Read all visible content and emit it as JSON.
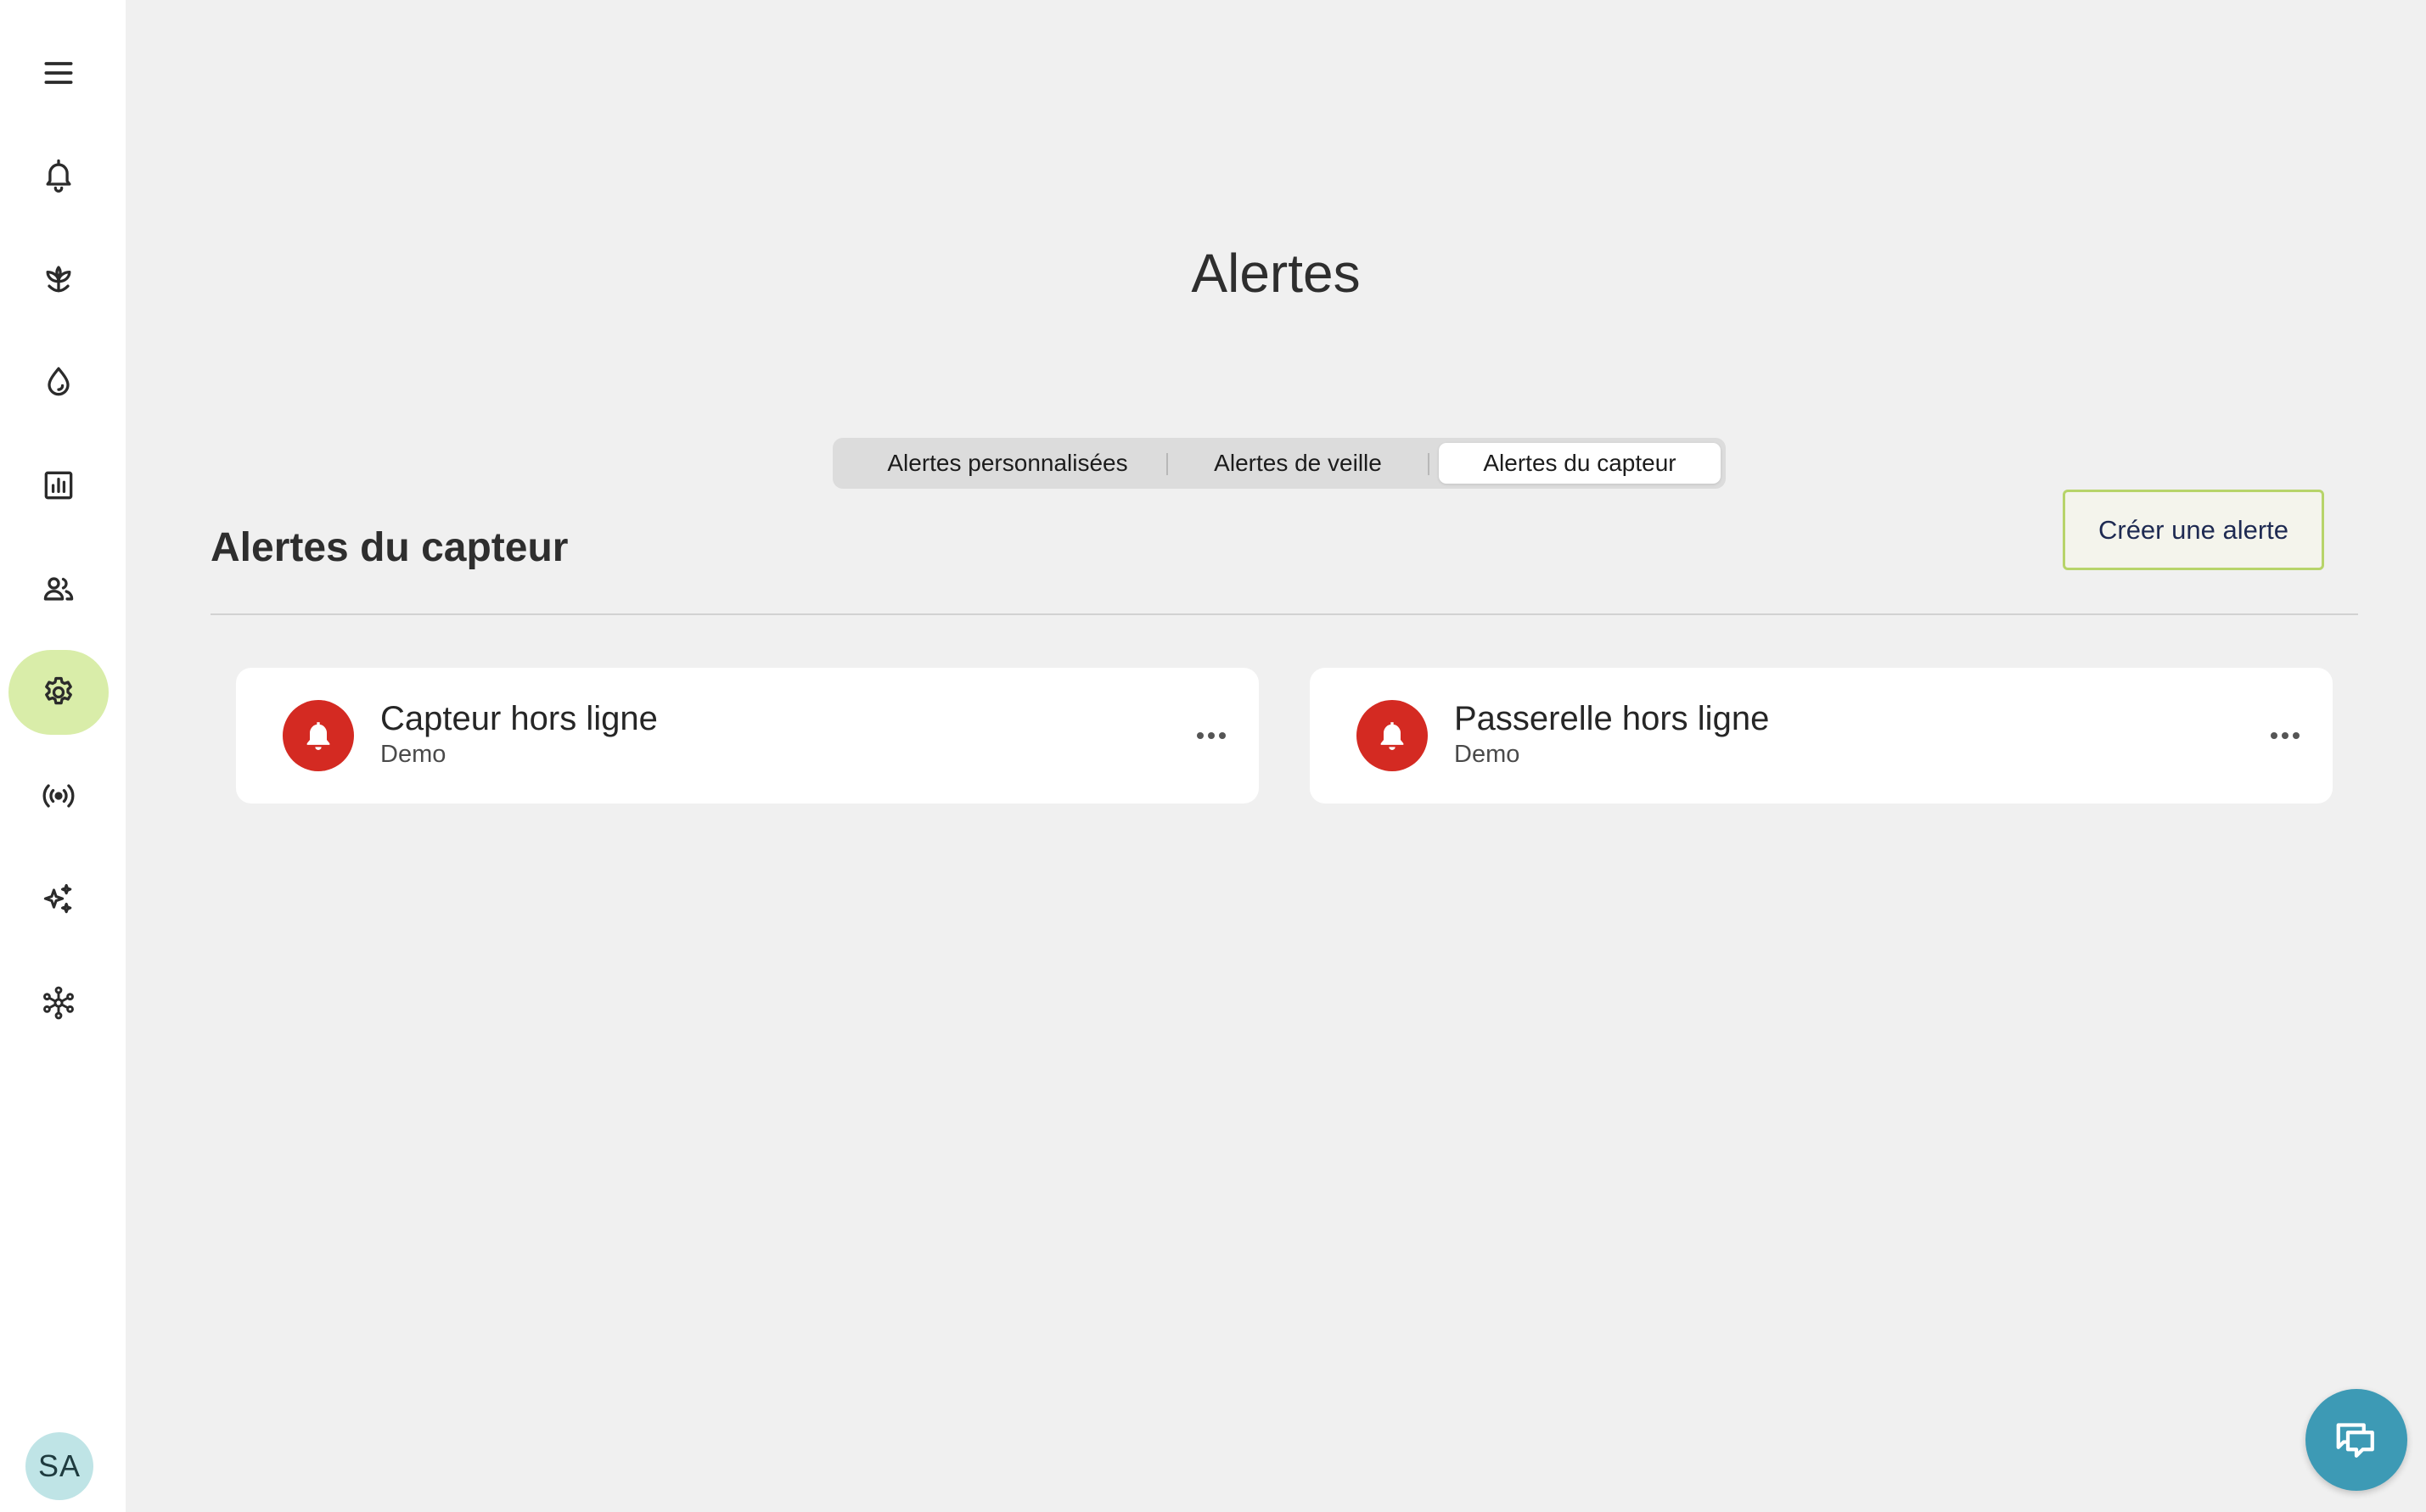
{
  "sidebar": {
    "items": [
      {
        "icon": "menu-icon"
      },
      {
        "icon": "bell-icon"
      },
      {
        "icon": "sprout-icon"
      },
      {
        "icon": "water-drop-icon"
      },
      {
        "icon": "bar-chart-icon"
      },
      {
        "icon": "users-icon"
      },
      {
        "icon": "gear-icon",
        "active": true
      },
      {
        "icon": "broadcast-icon"
      },
      {
        "icon": "sparkles-icon"
      },
      {
        "icon": "network-icon"
      }
    ],
    "avatar_initials": "SA"
  },
  "page": {
    "title": "Alertes"
  },
  "tabs": [
    {
      "label": "Alertes personnalisées",
      "active": false
    },
    {
      "label": "Alertes de veille",
      "active": false
    },
    {
      "label": "Alertes du capteur",
      "active": true
    }
  ],
  "section": {
    "title": "Alertes du capteur",
    "create_button_label": "Créer une alerte"
  },
  "alerts": [
    {
      "name": "Capteur hors ligne",
      "subtitle": "Demo",
      "icon": "bell-icon"
    },
    {
      "name": "Passerelle hors ligne",
      "subtitle": "Demo",
      "icon": "bell-icon"
    }
  ],
  "colors": {
    "accent_active": "#d9eda9",
    "alert_red": "#d42a22",
    "create_border": "#b7d46a",
    "chat_button": "#3d9ab5"
  },
  "chat_button": {
    "icon": "chat-icon"
  }
}
